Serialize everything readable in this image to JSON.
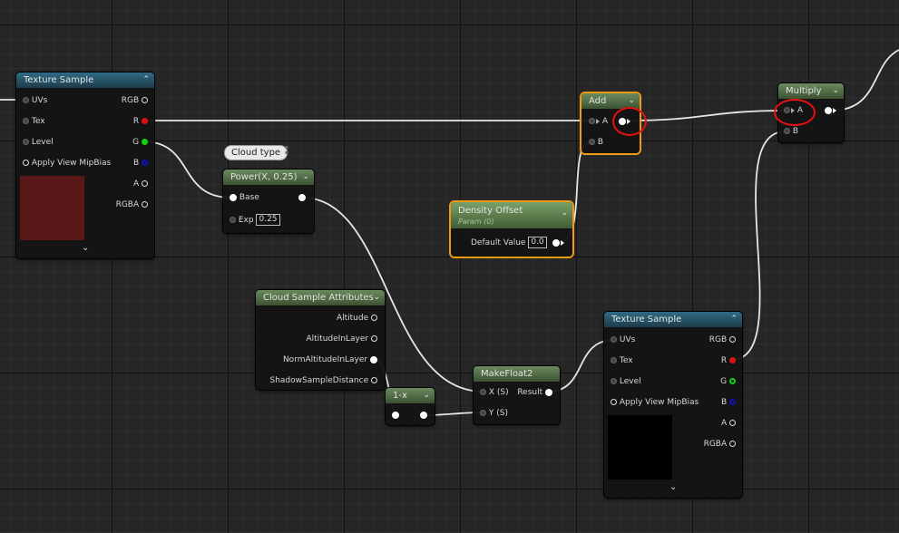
{
  "nodes": {
    "texture_sample_1": {
      "title": "Texture Sample",
      "inputs": [
        "UVs",
        "Tex",
        "Level",
        "Apply View MipBias"
      ],
      "outputs": [
        "RGB",
        "R",
        "G",
        "B",
        "A",
        "RGBA"
      ]
    },
    "comment_bubble": {
      "text": "Cloud type"
    },
    "power": {
      "title": "Power(X, 0.25)",
      "base_label": "Base",
      "exp_label": "Exp",
      "exp_value": "0.25"
    },
    "add": {
      "title": "Add",
      "input_a": "A",
      "input_b": "B"
    },
    "density_offset": {
      "title": "Density Offset",
      "subtitle": "Param (0)",
      "default_label": "Default Value",
      "default_value": "0.0"
    },
    "multiply": {
      "title": "Multiply",
      "input_a": "A",
      "input_b": "B"
    },
    "cloud_sample_attributes": {
      "title": "Cloud Sample Attributes",
      "outputs": [
        "Altitude",
        "AltitudeInLayer",
        "NormAltitudeInLayer",
        "ShadowSampleDistance"
      ]
    },
    "one_minus": {
      "title": "1-x"
    },
    "make_float2": {
      "title": "MakeFloat2",
      "input_x": "X (S)",
      "input_y": "Y (S)",
      "output": "Result"
    },
    "texture_sample_2": {
      "title": "Texture Sample",
      "inputs": [
        "UVs",
        "Tex",
        "Level",
        "Apply View MipBias"
      ],
      "outputs": [
        "RGB",
        "R",
        "G",
        "B",
        "A",
        "RGBA"
      ]
    }
  },
  "colors": {
    "selection": "#f09a14",
    "annotation": "#e81010",
    "preview_1": "#5a1717",
    "preview_2": "#000000"
  },
  "icons": {
    "collapse": "chevron-down-icon",
    "expand": "chevron-down-icon"
  }
}
